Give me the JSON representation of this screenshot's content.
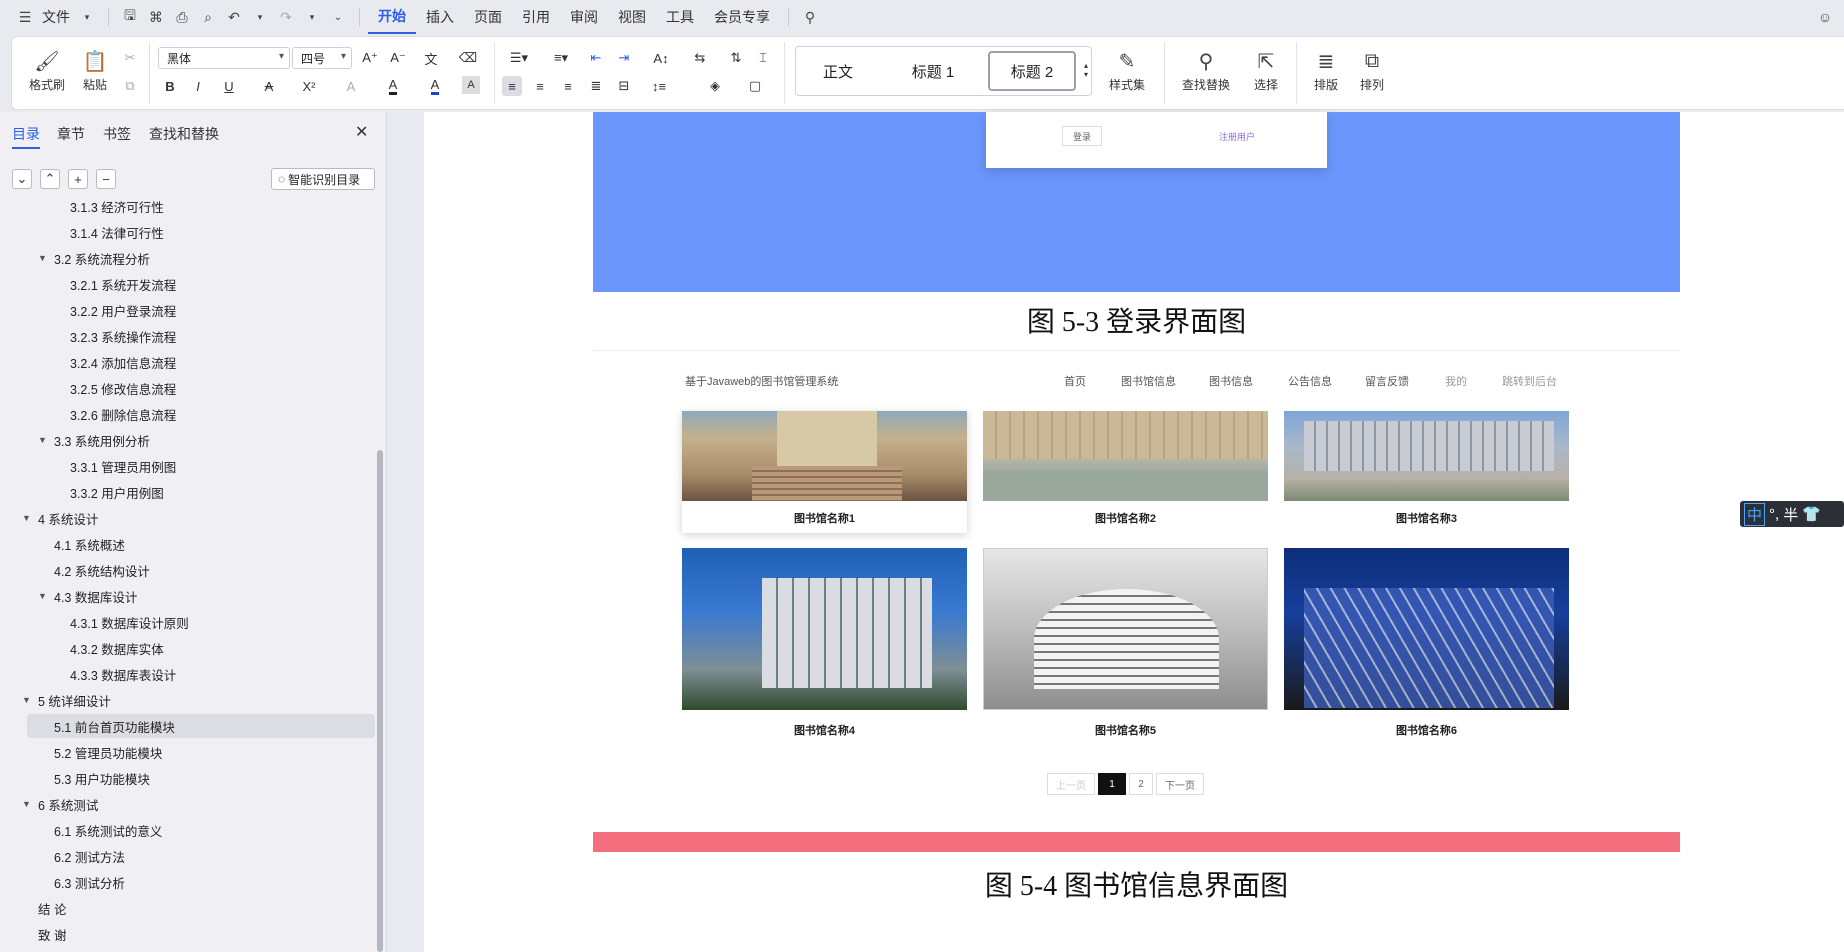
{
  "menu": {
    "file": "文件",
    "tabs": [
      "开始",
      "插入",
      "页面",
      "引用",
      "审阅",
      "视图",
      "工具",
      "会员专享"
    ]
  },
  "ribbon": {
    "format_painter": "格式刷",
    "paste": "粘贴",
    "font_name": "黑体",
    "font_size": "四号",
    "styles": [
      "正文",
      "标题 1",
      "标题 2"
    ],
    "style_set": "样式集",
    "find_replace": "查找替换",
    "select": "选择",
    "layout": "排版",
    "arrange": "排列"
  },
  "sidebar": {
    "tabs": [
      "目录",
      "章节",
      "书签",
      "查找和替换"
    ],
    "smart_toc": "智能识别目录",
    "toc": [
      {
        "label": "3.1.3  经济可行性",
        "level": 3
      },
      {
        "label": "3.1.4  法律可行性",
        "level": 3
      },
      {
        "label": "3.2 系统流程分析",
        "level": 2,
        "toggle": true
      },
      {
        "label": "3.2.1 系统开发流程",
        "level": 3
      },
      {
        "label": "3.2.2  用户登录流程",
        "level": 3
      },
      {
        "label": "3.2.3  系统操作流程",
        "level": 3
      },
      {
        "label": "3.2.4  添加信息流程",
        "level": 3
      },
      {
        "label": "3.2.5  修改信息流程",
        "level": 3
      },
      {
        "label": "3.2.6  删除信息流程",
        "level": 3
      },
      {
        "label": "3.3 系统用例分析",
        "level": 2,
        "toggle": true
      },
      {
        "label": "3.3.1 管理员用例图",
        "level": 3
      },
      {
        "label": "3.3.2 用户用例图",
        "level": 3
      },
      {
        "label": "4  系统设计",
        "level": 1,
        "toggle": true
      },
      {
        "label": "4.1  系统概述",
        "level": 2
      },
      {
        "label": "4.2  系统结构设计",
        "level": 2
      },
      {
        "label": "4.3 数据库设计",
        "level": 2,
        "toggle": true
      },
      {
        "label": "4.3.1  数据库设计原则",
        "level": 3
      },
      {
        "label": "4.3.2  数据库实体",
        "level": 3
      },
      {
        "label": "4.3.3  数据库表设计",
        "level": 3
      },
      {
        "label": "5 统详细设计",
        "level": 1,
        "toggle": true
      },
      {
        "label": "5.1 前台首页功能模块",
        "level": 2,
        "selected": true
      },
      {
        "label": "5.2 管理员功能模块",
        "level": 2
      },
      {
        "label": "5.3 用户功能模块",
        "level": 2
      },
      {
        "label": "6 系统测试",
        "level": 1,
        "toggle": true
      },
      {
        "label": "6.1 系统测试的意义",
        "level": 2
      },
      {
        "label": "6.2  测试方法",
        "level": 2
      },
      {
        "label": "6.3 测试分析",
        "level": 2
      },
      {
        "label": "结    论",
        "level": 1
      },
      {
        "label": "致    谢",
        "level": 1
      }
    ]
  },
  "doc": {
    "login_btn": "登录",
    "register_link": "注册用户",
    "caption1": "图 5-3 登录界面图",
    "site_title": "基于Javaweb的图书馆管理系统",
    "nav": [
      "首页",
      "图书馆信息",
      "图书信息",
      "公告信息",
      "留言反馈",
      "我的",
      "跳转到后台"
    ],
    "libs": [
      "图书馆名称1",
      "图书馆名称2",
      "图书馆名称3",
      "图书馆名称4",
      "图书馆名称5",
      "图书馆名称6"
    ],
    "pager": {
      "prev": "上一页",
      "p1": "1",
      "p2": "2",
      "next": "下一页"
    },
    "caption2": "图 5-4 图书馆信息界面图"
  },
  "ime": {
    "lang": "中",
    "punct": "°,",
    "width": "半"
  },
  "colors": {
    "accent": "#2e5ee6",
    "login_bg": "#6b96fc",
    "footer_bar": "#f36f7d"
  }
}
